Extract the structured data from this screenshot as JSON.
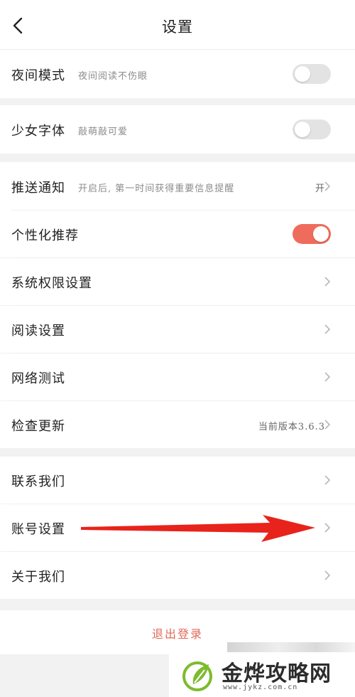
{
  "header": {
    "title": "设置"
  },
  "rows": {
    "night_mode": {
      "label": "夜间模式",
      "sub": "夜间阅读不伤眼",
      "toggle_on": false
    },
    "girl_font": {
      "label": "少女字体",
      "sub": "敲萌敲可爱",
      "toggle_on": false
    },
    "push": {
      "label": "推送通知",
      "sub": "开启后, 第一时间获得重要信息提醒",
      "value": "开"
    },
    "personalized": {
      "label": "个性化推荐",
      "toggle_on": true
    },
    "permissions": {
      "label": "系统权限设置"
    },
    "reading": {
      "label": "阅读设置"
    },
    "network": {
      "label": "网络测试"
    },
    "update": {
      "label": "检查更新",
      "value": "当前版本3.6.3"
    },
    "contact": {
      "label": "联系我们"
    },
    "account": {
      "label": "账号设置"
    },
    "about": {
      "label": "关于我们"
    }
  },
  "logout": {
    "label": "退出登录"
  },
  "watermark": {
    "text": "金烨攻略网",
    "url": "www.jykz.com.cn"
  },
  "colors": {
    "accent": "#ef6c5c",
    "logout": "#e06a57",
    "arrow": "#e8231b"
  }
}
